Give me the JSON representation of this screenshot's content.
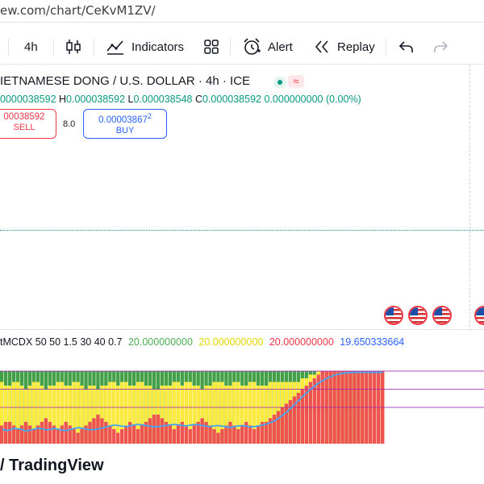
{
  "browser": {
    "url": "ew.com/chart/CeKvM1ZV/"
  },
  "toolbar": {
    "interval": "4h",
    "indicators_label": "Indicators",
    "alert_label": "Alert",
    "replay_label": "Replay"
  },
  "symbol": {
    "title": "IETNAMESE DONG / U.S. DOLLAR · 4h · ICE",
    "market_open_status": "green",
    "delay_badge": "≈"
  },
  "ohlc": {
    "o_value": "0000038592",
    "h_label": "H",
    "h_value": "0.000038592",
    "l_label": "L",
    "l_value": "0.000038548",
    "c_label": "C",
    "c_value": "0.000038592",
    "change": "0.000000000 (0.00%)"
  },
  "trade": {
    "sell_price": "00038592",
    "sell_label": "SELL",
    "spread": "8.0",
    "buy_price": "0.00003867",
    "buy_price_sup": "2",
    "buy_label": "BUY"
  },
  "events": {
    "icon": "us-flag-icon",
    "count_visible": 4
  },
  "indicator": {
    "name": "tMCDX 50 50 1.5 30 40 0.7",
    "v1": "20.000000000",
    "v2": "20.000000000",
    "v3": "20.000000000",
    "v4": "19.650333664",
    "colors": {
      "v1": "#4caf50",
      "v2": "#e6d800",
      "v3": "#f23645",
      "v4": "#2962ff"
    }
  },
  "indicator_series": {
    "bars": 96,
    "red_level": [
      5,
      6,
      6,
      5,
      4,
      5,
      6,
      5,
      4,
      5,
      6,
      7,
      6,
      5,
      4,
      5,
      6,
      5,
      4,
      3,
      4,
      5,
      6,
      7,
      8,
      7,
      6,
      5,
      4,
      3,
      4,
      5,
      6,
      5,
      4,
      5,
      6,
      7,
      8,
      8,
      7,
      6,
      5,
      4,
      5,
      6,
      5,
      4,
      5,
      6,
      7,
      6,
      5,
      4,
      3,
      4,
      5,
      6,
      5,
      4,
      5,
      6,
      5,
      4,
      5,
      6,
      6,
      7,
      8,
      9,
      10,
      11,
      12,
      13,
      14,
      15,
      16,
      17,
      18,
      19,
      20,
      20,
      20,
      20,
      20,
      20,
      20,
      20,
      20,
      20,
      20,
      20,
      20,
      20,
      20,
      20
    ],
    "yellow_level": [
      17,
      16,
      16,
      17,
      17,
      16,
      15,
      16,
      17,
      17,
      16,
      15,
      16,
      16,
      17,
      17,
      16,
      16,
      17,
      17,
      16,
      15,
      16,
      16,
      15,
      16,
      16,
      17,
      17,
      16,
      17,
      17,
      16,
      16,
      17,
      17,
      16,
      16,
      15,
      15,
      16,
      16,
      16,
      17,
      17,
      16,
      17,
      17,
      16,
      16,
      15,
      16,
      16,
      17,
      17,
      17,
      16,
      16,
      17,
      17,
      16,
      16,
      17,
      17,
      16,
      16,
      16,
      17,
      17,
      17,
      17,
      17,
      17,
      17,
      17,
      18,
      18,
      19,
      19,
      20,
      20,
      20,
      20,
      20,
      20,
      20,
      20,
      20,
      20,
      20,
      20,
      20,
      20,
      20,
      20,
      20
    ],
    "line": [
      4.0,
      3.6,
      3.8,
      4.2,
      4.1,
      3.9,
      3.5,
      3.7,
      4.0,
      4.3,
      4.1,
      3.8,
      3.9,
      4.2,
      4.0,
      3.7,
      3.6,
      3.9,
      4.2,
      4.4,
      4.3,
      4.0,
      3.8,
      3.9,
      4.1,
      4.3,
      4.6,
      4.9,
      5.1,
      5.0,
      4.8,
      4.7,
      4.9,
      5.2,
      5.3,
      5.2,
      5.0,
      4.8,
      4.6,
      4.7,
      4.9,
      5.0,
      5.2,
      5.3,
      5.2,
      5.0,
      4.9,
      5.1,
      5.3,
      5.2,
      5.0,
      4.8,
      4.7,
      4.9,
      5.0,
      4.8,
      4.6,
      4.5,
      4.7,
      4.9,
      5.0,
      4.8,
      4.6,
      4.7,
      4.9,
      5.1,
      5.4,
      5.8,
      6.3,
      7.0,
      7.8,
      8.7,
      9.7,
      10.8,
      11.9,
      13.0,
      14.0,
      15.0,
      15.9,
      16.7,
      17.4,
      18.0,
      18.5,
      18.9,
      19.2,
      19.4,
      19.5,
      19.6,
      19.65,
      19.65,
      19.65,
      19.65,
      19.65,
      19.65,
      19.65,
      19.65
    ],
    "levels": [
      20,
      15,
      10
    ],
    "colors": {
      "red": "#ef5350",
      "yellow": "#ffeb3b",
      "green": "#43a047",
      "line": "#42a5f5",
      "level": "#9c27b0"
    }
  },
  "brand": {
    "name": "TradingView"
  }
}
